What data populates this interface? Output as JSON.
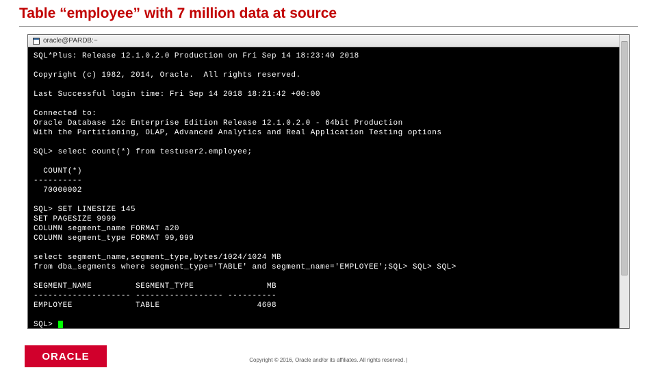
{
  "title": "Table “employee” with 7 million data at source",
  "window": {
    "title": "oracle@PARDB:~"
  },
  "terminal": {
    "lines": [
      "SQL*Plus: Release 12.1.0.2.0 Production on Fri Sep 14 18:23:40 2018",
      "",
      "Copyright (c) 1982, 2014, Oracle.  All rights reserved.",
      "",
      "Last Successful login time: Fri Sep 14 2018 18:21:42 +00:00",
      "",
      "Connected to:",
      "Oracle Database 12c Enterprise Edition Release 12.1.0.2.0 - 64bit Production",
      "With the Partitioning, OLAP, Advanced Analytics and Real Application Testing options",
      "",
      "SQL> select count(*) from testuser2.employee;",
      "",
      "  COUNT(*)",
      "----------",
      "  70000002",
      "",
      "SQL> SET LINESIZE 145",
      "SET PAGESIZE 9999",
      "COLUMN segment_name FORMAT a20",
      "COLUMN segment_type FORMAT 99,999",
      "",
      "select segment_name,segment_type,bytes/1024/1024 MB",
      "from dba_segments where segment_type='TABLE' and segment_name='EMPLOYEE';SQL> SQL> SQL>",
      "",
      "SEGMENT_NAME         SEGMENT_TYPE               MB",
      "-------------------- ------------------ ----------",
      "EMPLOYEE             TABLE                    4608",
      "",
      "SQL> "
    ]
  },
  "logo_text": "ORACLE",
  "copyright": "Copyright © 2016, Oracle and/or its affiliates. All rights reserved.   |"
}
